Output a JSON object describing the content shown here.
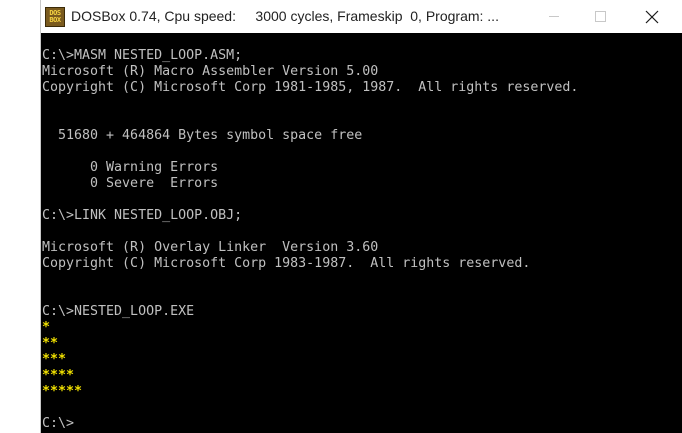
{
  "window": {
    "title": "DOSBox 0.74, Cpu speed:     3000 cycles, Frameskip  0, Program: ...",
    "icon_text_top": "DOS",
    "icon_text_bottom": "BOX",
    "icon": "dosbox-app-icon",
    "controls": {
      "minimize_icon": "minimize-icon",
      "maximize_icon": "maximize-icon",
      "close_icon": "close-icon",
      "close_glyph": "✕"
    }
  },
  "terminal": {
    "background": "#000000",
    "text_color": "#c0c0c0",
    "highlight_color": "#f0e000",
    "lines": [
      {
        "text": "C:\\>MASM NESTED_LOOP.ASM;",
        "row": 0
      },
      {
        "text": "Microsoft (R) Macro Assembler Version 5.00",
        "row": 1
      },
      {
        "text": "Copyright (C) Microsoft Corp 1981-1985, 1987.  All rights reserved.",
        "row": 2
      },
      {
        "text": "  51680 + 464864 Bytes symbol space free",
        "row": 5
      },
      {
        "text": "      0 Warning Errors",
        "row": 7
      },
      {
        "text": "      0 Severe  Errors",
        "row": 8
      },
      {
        "text": "C:\\>LINK NESTED_LOOP.OBJ;",
        "row": 10
      },
      {
        "text": "Microsoft (R) Overlay Linker  Version 3.60",
        "row": 12
      },
      {
        "text": "Copyright (C) Microsoft Corp 1983-1987.  All rights reserved.",
        "row": 13
      },
      {
        "text": "C:\\>NESTED_LOOP.EXE",
        "row": 16
      },
      {
        "text": "*",
        "row": 17,
        "star": true
      },
      {
        "text": "**",
        "row": 18,
        "star": true
      },
      {
        "text": "***",
        "row": 19,
        "star": true
      },
      {
        "text": "****",
        "row": 20,
        "star": true
      },
      {
        "text": "*****",
        "row": 21,
        "star": true
      },
      {
        "text": "C:\\>",
        "row": 23
      }
    ]
  }
}
